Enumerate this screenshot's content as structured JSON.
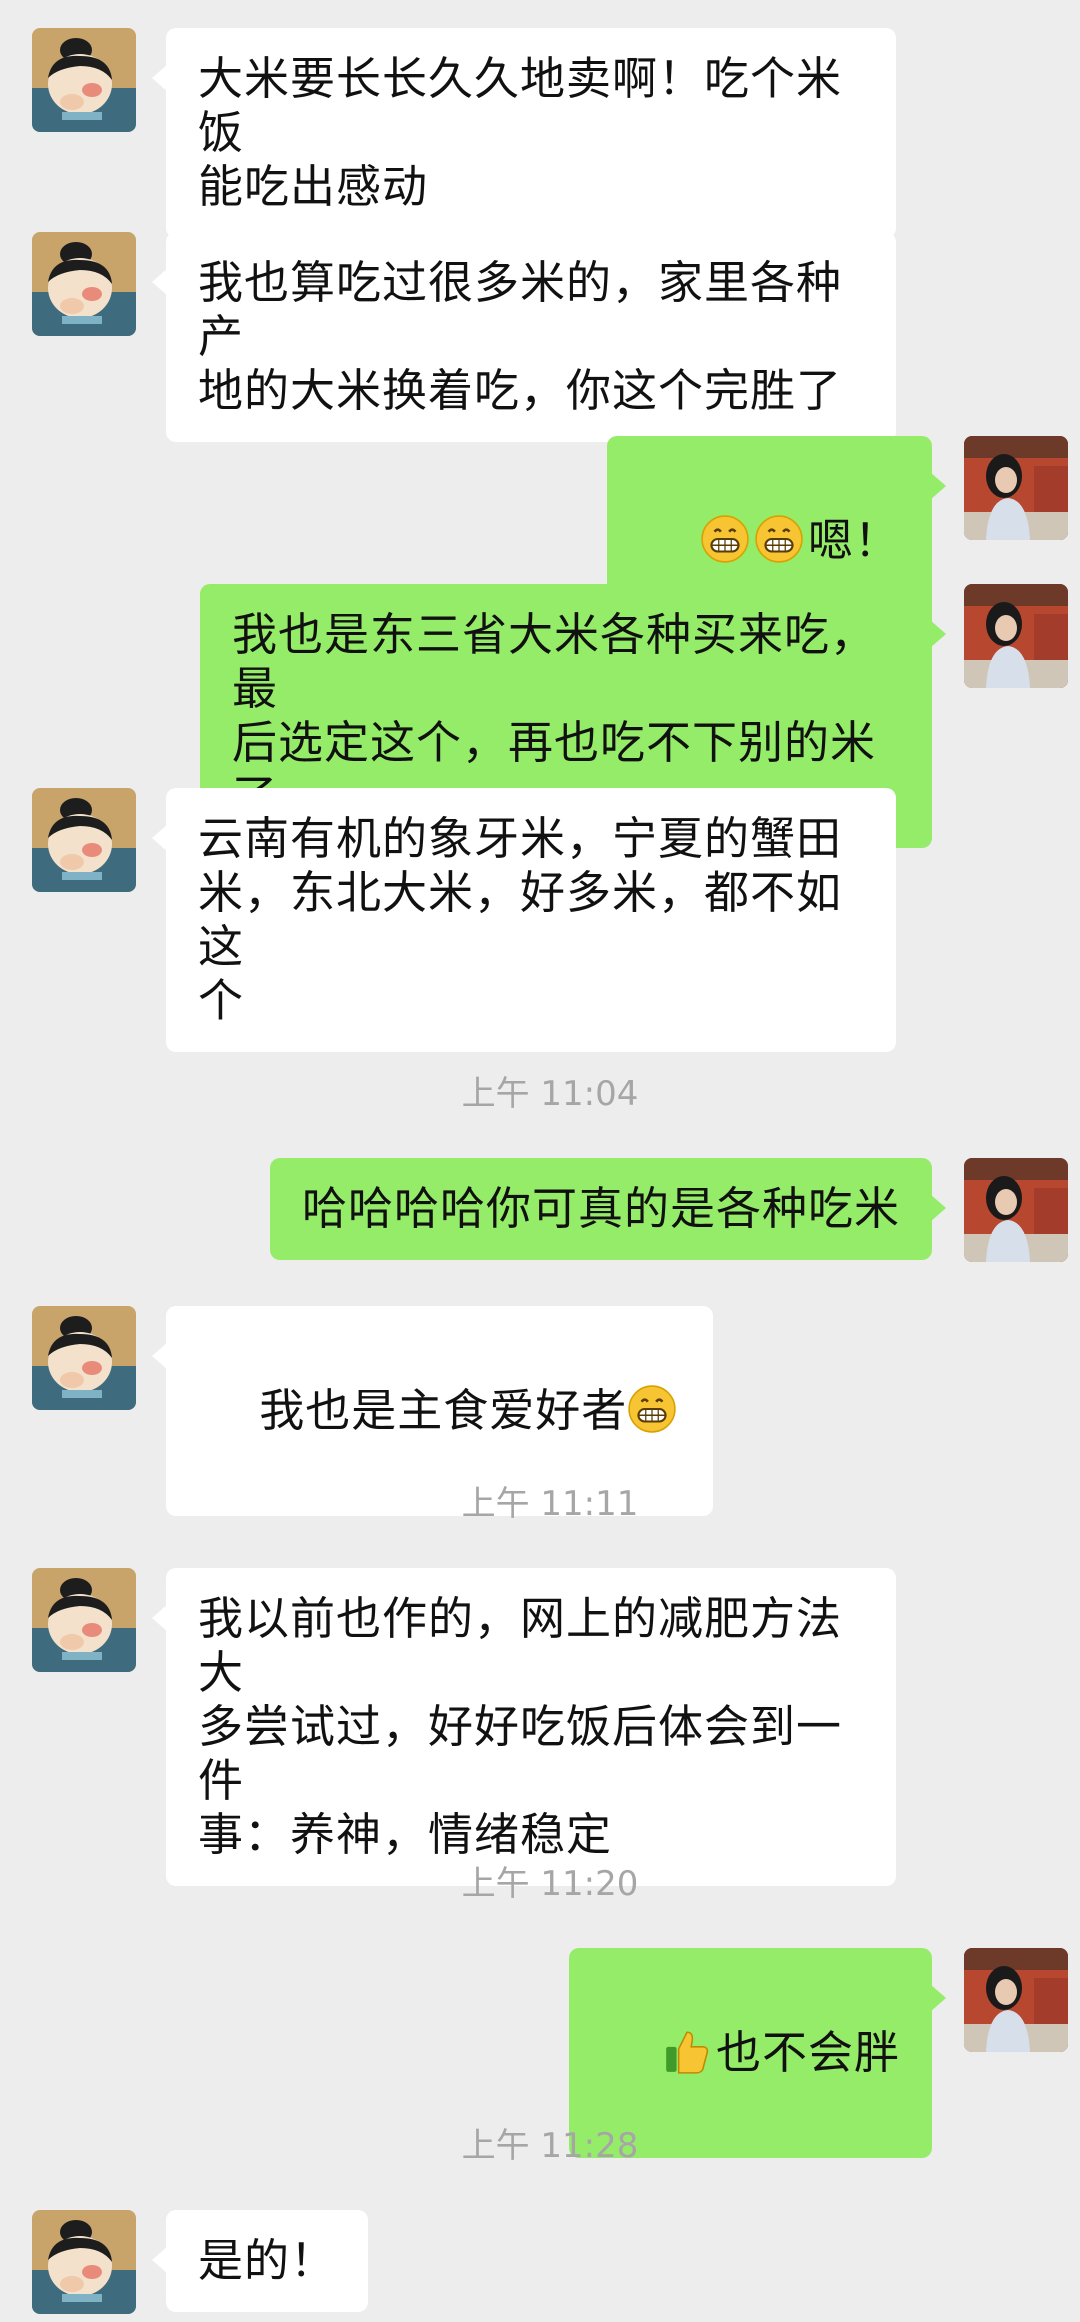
{
  "messages": [
    {
      "side": "in",
      "text": "大米要长长久久地卖啊！吃个米饭\n能吃出感动"
    },
    {
      "side": "in",
      "text": "我也算吃过很多米的，家里各种产\n地的大米换着吃，你这个完胜了"
    },
    {
      "side": "out",
      "emoji": [
        "grin-emoji",
        "grin-emoji"
      ],
      "text": "嗯！"
    },
    {
      "side": "out",
      "text": "我也是东三省大米各种买来吃，最\n后选定这个，再也吃不下别的米了"
    },
    {
      "side": "in",
      "text": "云南有机的象牙米，宁夏的蟹田\n米，东北大米，好多米，都不如这\n个"
    },
    {
      "time": "上午 11:04"
    },
    {
      "side": "out",
      "text": "哈哈哈哈你可真的是各种吃米"
    },
    {
      "side": "in",
      "text": "我也是主食爱好者",
      "trailing_emoji": "grin-emoji"
    },
    {
      "time": "上午 11:11"
    },
    {
      "side": "in",
      "text": "我以前也作的，网上的减肥方法大\n多尝试过，好好吃饭后体会到一件\n事：养神，情绪稳定"
    },
    {
      "time": "上午 11:20"
    },
    {
      "side": "out",
      "emoji": [
        "thumbs-up-emoji"
      ],
      "text": "也不会胖"
    },
    {
      "time": "上午 11:28"
    },
    {
      "side": "in",
      "text": "是的！"
    }
  ],
  "colors": {
    "background": "#ededed",
    "incoming": "#ffffff",
    "outgoing": "#95ec69",
    "time": "#a6a6a6"
  }
}
